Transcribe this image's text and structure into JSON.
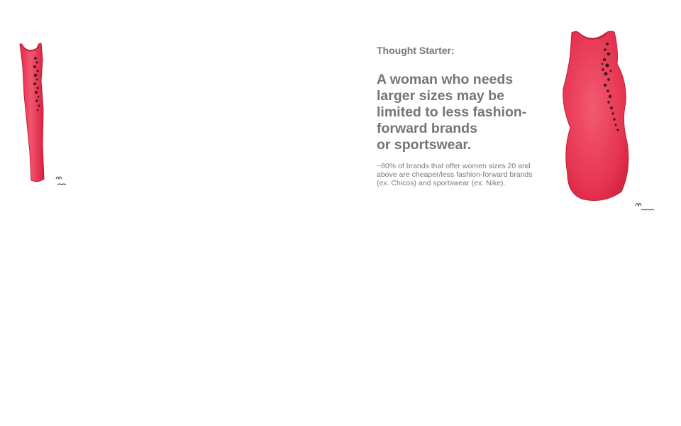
{
  "slide": {
    "label": "Thought Starter:",
    "headline_lines": [
      "A woman who needs",
      "larger sizes may be",
      "limited to less fashion-",
      "forward brands",
      "or sportswear."
    ],
    "note_lines": [
      "~80% of brands that offer women sizes 20 and",
      "above are cheaper/less fashion-forward brands",
      "(ex. Chicos) and sportswear (ex. Nike)."
    ]
  },
  "illustrations": {
    "dress_color": "#e8334f",
    "sequin_color": "#3a1420",
    "signature_text": "Hu 2019"
  }
}
